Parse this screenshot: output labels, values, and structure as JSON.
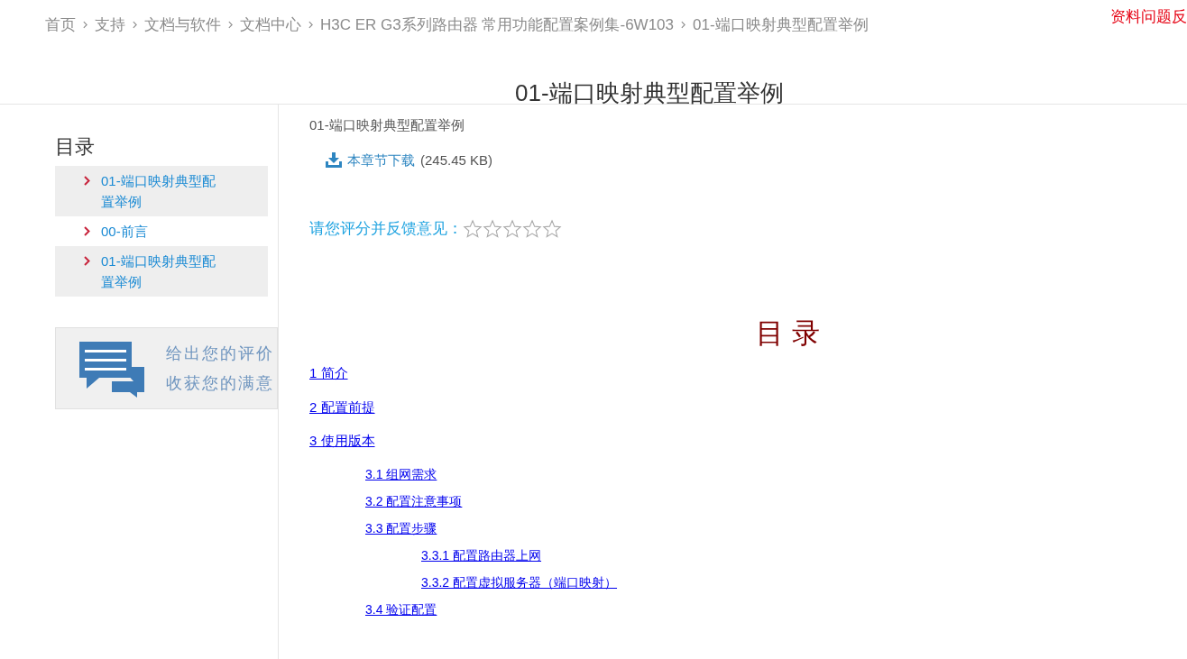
{
  "breadcrumb": [
    "首页",
    "支持",
    "文档与软件",
    "文档中心",
    "H3C ER G3系列路由器 常用功能配置案例集-6W103",
    "01-端口映射典型配置举例"
  ],
  "feedback_link": "资料问题反",
  "page_title": "01-端口映射典型配置举例",
  "sidebar": {
    "title": "目录",
    "items": [
      {
        "label": "01-端口映射典型配置举例",
        "selected": true
      },
      {
        "label": "00-前言",
        "selected": false
      },
      {
        "label": "01-端口映射典型配置举例",
        "selected": true
      }
    ],
    "promo": [
      "给出您的评价",
      "收获您的满意"
    ]
  },
  "content": {
    "section_title": "01-端口映射典型配置举例",
    "download": {
      "label": "本章节下载",
      "size": "(245.45 KB)"
    },
    "rating": {
      "label": "请您评分并反馈意见：",
      "stars": 0
    },
    "toc_title": "目 录",
    "toc": [
      {
        "label": "1 简介"
      },
      {
        "label": "2 配置前提"
      },
      {
        "label": "3 使用版本",
        "children": [
          {
            "label": "3.1 组网需求"
          },
          {
            "label": "3.2 配置注意事项"
          },
          {
            "label": "3.3 配置步骤",
            "children": [
              {
                "label": "3.3.1 配置路由器上网"
              },
              {
                "label": "3.3.2 配置虚拟服务器（端口映射）"
              }
            ]
          },
          {
            "label": "3.4 验证配置"
          }
        ]
      }
    ]
  }
}
